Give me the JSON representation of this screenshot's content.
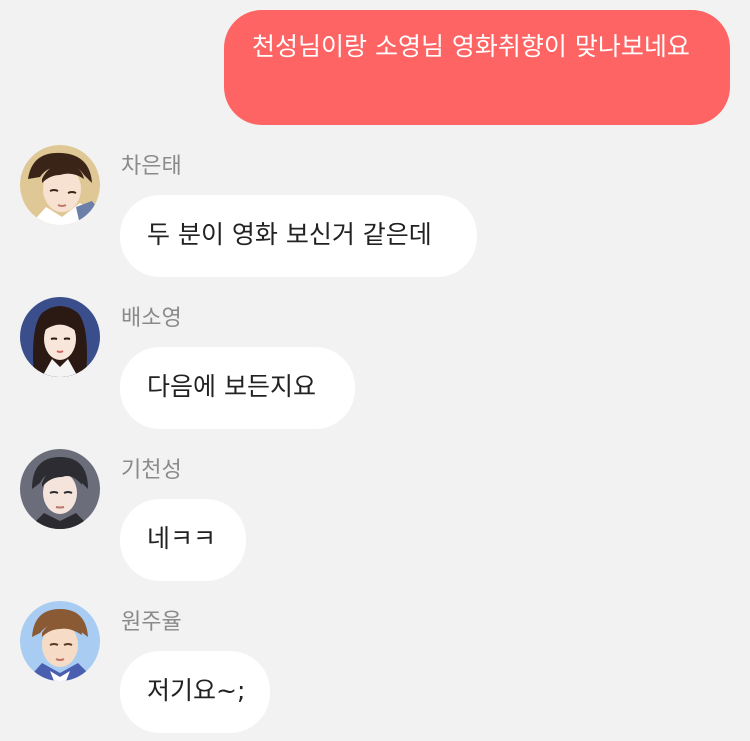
{
  "my_message": {
    "text": "천성님이랑 소영님 영화취향이 맞나보네요"
  },
  "messages": [
    {
      "sender": "차은태",
      "text": "두 분이 영화 보신거 같은데",
      "avatar": "avatar-illustration"
    },
    {
      "sender": "배소영",
      "text": "다음에 보든지요",
      "avatar": "avatar-illustration"
    },
    {
      "sender": "기천성",
      "text": "네ㅋㅋ",
      "avatar": "avatar-illustration"
    },
    {
      "sender": "원주율",
      "text": "저기요~;",
      "avatar": "avatar-illustration"
    }
  ],
  "colors": {
    "background": "#f2f2f2",
    "my_bubble": "#ff6464",
    "other_bubble": "#ffffff",
    "sender_text": "#8a8a8a"
  }
}
